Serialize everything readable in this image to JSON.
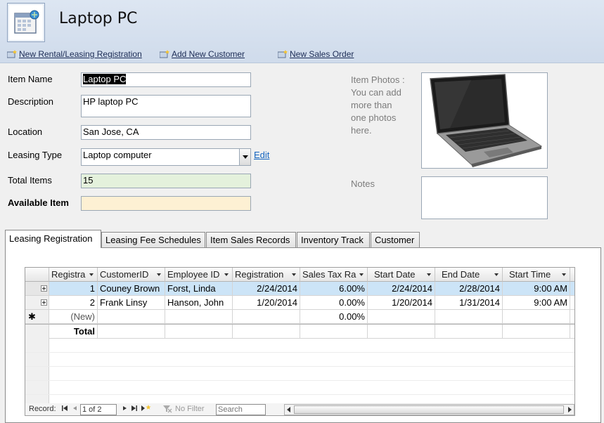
{
  "header": {
    "title": "Laptop PC",
    "links": [
      {
        "label": "New Rental/Leasing Registration"
      },
      {
        "label": "Add New Customer"
      },
      {
        "label": "New Sales Order"
      }
    ]
  },
  "form": {
    "item_name_label": "Item Name",
    "item_name_value": "Laptop PC",
    "description_label": "Description",
    "description_value": "HP laptop PC",
    "location_label": "Location",
    "location_value": "San Jose, CA",
    "leasing_type_label": "Leasing Type",
    "leasing_type_value": "Laptop computer",
    "edit_link": "Edit",
    "total_items_label": "Total Items",
    "total_items_value": "15",
    "available_item_label": "Available Item",
    "available_item_value": "",
    "photos_label": [
      "Item Photos :",
      "You can add",
      "more than",
      "one photos",
      "here."
    ],
    "notes_label": "Notes"
  },
  "tabs": [
    {
      "label": "Leasing Registration",
      "active": true
    },
    {
      "label": "Leasing Fee Schedules",
      "active": false
    },
    {
      "label": "Item Sales Records",
      "active": false
    },
    {
      "label": "Inventory Track",
      "active": false
    },
    {
      "label": "Customer",
      "active": false
    }
  ],
  "grid": {
    "columns": [
      "Registra",
      "CustomerID",
      "Employee ID",
      "Registration",
      "Sales Tax Ra",
      "Start Date",
      "End Date",
      "Start Time"
    ],
    "rows": [
      [
        "1",
        "Couney Brown",
        "Forst, Linda",
        "2/24/2014",
        "6.00%",
        "2/24/2014",
        "2/28/2014",
        "9:00 AM"
      ],
      [
        "2",
        "Frank Linsy",
        "Hanson, John",
        "1/20/2014",
        "0.00%",
        "1/20/2014",
        "1/31/2014",
        "9:00 AM"
      ]
    ],
    "new_row": {
      "label": "(New)",
      "tax": "0.00%"
    },
    "total_row": {
      "label": "Total"
    }
  },
  "record_nav": {
    "record_label": "Record:",
    "record_value": "1 of 2",
    "filter_label": "No Filter",
    "search_placeholder": "Search"
  }
}
